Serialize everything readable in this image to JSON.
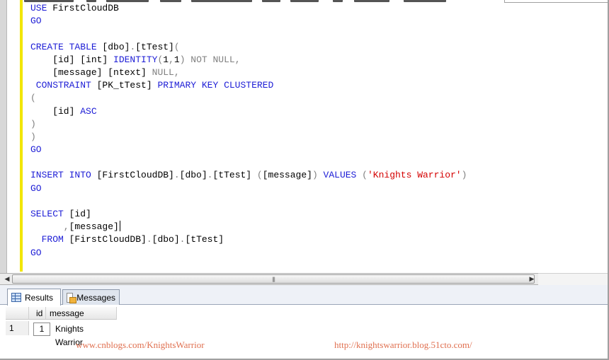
{
  "editor": {
    "lines": [
      {
        "segs": [
          {
            "c": "kw",
            "t": "USE "
          },
          {
            "t": "FirstCloudDB"
          }
        ]
      },
      {
        "segs": [
          {
            "c": "kw",
            "t": "GO"
          }
        ]
      },
      {
        "segs": []
      },
      {
        "segs": [
          {
            "c": "kw",
            "t": "CREATE TABLE "
          },
          {
            "t": "[dbo]"
          },
          {
            "c": "gry",
            "t": "."
          },
          {
            "t": "[tTest]"
          },
          {
            "c": "gry",
            "t": "("
          }
        ]
      },
      {
        "segs": [
          {
            "t": "    [id] [int] "
          },
          {
            "c": "kw",
            "t": "IDENTITY"
          },
          {
            "c": "gry",
            "t": "("
          },
          {
            "t": "1"
          },
          {
            "c": "gry",
            "t": ","
          },
          {
            "t": "1"
          },
          {
            "c": "gry",
            "t": ") NOT NULL,"
          }
        ]
      },
      {
        "segs": [
          {
            "t": "    [message] [ntext] "
          },
          {
            "c": "gry",
            "t": "NULL,"
          }
        ]
      },
      {
        "segs": [
          {
            "c": "kw",
            "t": " CONSTRAINT "
          },
          {
            "t": "[PK_tTest] "
          },
          {
            "c": "kw",
            "t": "PRIMARY KEY CLUSTERED"
          }
        ]
      },
      {
        "segs": [
          {
            "c": "gry",
            "t": "("
          }
        ]
      },
      {
        "segs": [
          {
            "t": "    [id] "
          },
          {
            "c": "kw",
            "t": "ASC"
          }
        ]
      },
      {
        "segs": [
          {
            "c": "gry",
            "t": ")"
          }
        ]
      },
      {
        "segs": [
          {
            "c": "gry",
            "t": ")"
          }
        ]
      },
      {
        "segs": [
          {
            "c": "kw",
            "t": "GO"
          }
        ]
      },
      {
        "segs": []
      },
      {
        "segs": [
          {
            "c": "kw",
            "t": "INSERT INTO "
          },
          {
            "t": "[FirstCloudDB]"
          },
          {
            "c": "gry",
            "t": "."
          },
          {
            "t": "[dbo]"
          },
          {
            "c": "gry",
            "t": "."
          },
          {
            "t": "[tTest] "
          },
          {
            "c": "gry",
            "t": "("
          },
          {
            "t": "[message]"
          },
          {
            "c": "gry",
            "t": ")"
          },
          {
            "c": "kw",
            "t": " VALUES "
          },
          {
            "c": "gry",
            "t": "("
          },
          {
            "c": "str",
            "t": "'Knights Warrior'"
          },
          {
            "c": "gry",
            "t": ")"
          }
        ]
      },
      {
        "segs": [
          {
            "c": "kw",
            "t": "GO"
          }
        ]
      },
      {
        "segs": []
      },
      {
        "segs": [
          {
            "c": "kw",
            "t": "SELECT "
          },
          {
            "t": "[id]"
          }
        ]
      },
      {
        "segs": [
          {
            "c": "gry",
            "t": "      ,"
          },
          {
            "t": "[message]"
          }
        ],
        "caret": true
      },
      {
        "segs": [
          {
            "c": "kw",
            "t": "  FROM "
          },
          {
            "t": "[FirstCloudDB]"
          },
          {
            "c": "gry",
            "t": "."
          },
          {
            "t": "[dbo]"
          },
          {
            "c": "gry",
            "t": "."
          },
          {
            "t": "[tTest]"
          }
        ]
      },
      {
        "segs": [
          {
            "c": "kw",
            "t": "GO"
          }
        ]
      }
    ]
  },
  "scrollbar": {
    "left_icon": "scroll-left-arrow",
    "right_icon": "scroll-right-arrow",
    "grip": "|||"
  },
  "tabs": {
    "results_label": "Results",
    "messages_label": "Messages",
    "results_icon": "grid-icon",
    "messages_icon": "message-icon"
  },
  "grid": {
    "columns": [
      "id",
      "message"
    ],
    "rows": [
      {
        "rownum": "1",
        "id": "1",
        "message": "Knights Warrior"
      }
    ]
  },
  "watermarks": {
    "left": "www.cnblogs.com/KnightsWarrior",
    "right": "http://knightswarrior.blog.51cto.com/"
  },
  "colors": {
    "keyword": "#1d1dd6",
    "string": "#d40000",
    "operator": "#808080",
    "change_bar": "#f2e600",
    "watermark": "#e07050"
  }
}
